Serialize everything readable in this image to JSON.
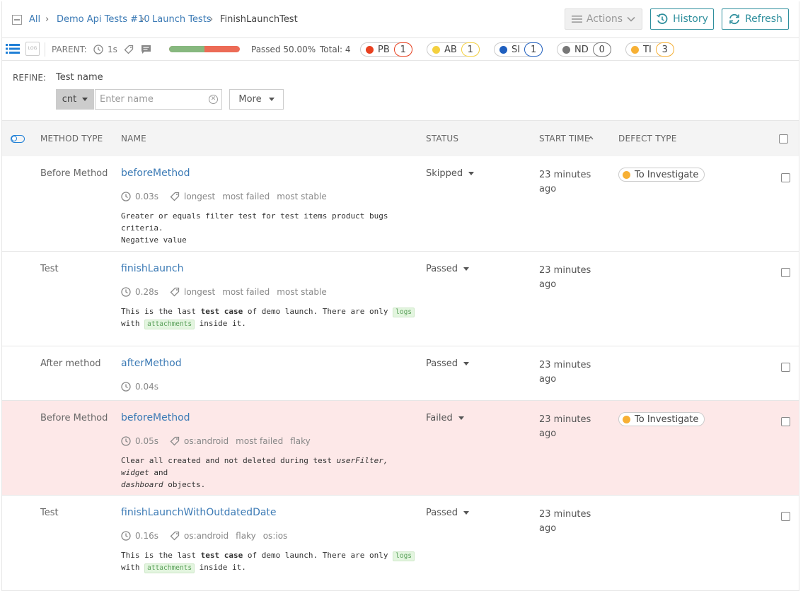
{
  "breadcrumb": {
    "all": "All",
    "launch": "Demo Api Tests #10",
    "suite": "Launch Tests",
    "current": "FinishLaunchTest"
  },
  "toolbar": {
    "actions_label": "Actions",
    "history_label": "History",
    "refresh_label": "Refresh"
  },
  "infobar": {
    "log_label": "LOG",
    "parent_label": "PARENT:",
    "duration": "1s",
    "passed_fraction": 0.5,
    "passed_text": "Passed 50.00%",
    "total_text": "Total: 4",
    "defects": [
      {
        "label": "PB",
        "count": "1",
        "color": "#e8401f"
      },
      {
        "label": "AB",
        "count": "1",
        "color": "#f4d03f"
      },
      {
        "label": "SI",
        "count": "1",
        "color": "#1f5fbf"
      },
      {
        "label": "ND",
        "count": "0",
        "color": "#777777"
      },
      {
        "label": "TI",
        "count": "3",
        "color": "#f7b034"
      }
    ]
  },
  "refine": {
    "label": "REFINE:",
    "field_label": "Test name",
    "condition": "cnt",
    "placeholder": "Enter name",
    "more_label": "More"
  },
  "table": {
    "headers": {
      "method_type": "METHOD TYPE",
      "name": "NAME",
      "status": "STATUS",
      "start_time": "START TIME",
      "defect_type": "DEFECT TYPE"
    },
    "rows": [
      {
        "method_type": "Before Method",
        "name": "beforeMethod",
        "duration": "0.03s",
        "tags": [
          "longest",
          "most failed",
          "most stable"
        ],
        "status": "Skipped",
        "time1": "23 minutes",
        "time2": "ago",
        "defect": "To Investigate",
        "desc1": "Greater or equals filter test for test items product bugs criteria.",
        "desc2": "Negative value"
      },
      {
        "method_type": "Test",
        "name": "finishLaunch",
        "duration": "0.28s",
        "tags": [
          "longest",
          "most failed",
          "most stable"
        ],
        "status": "Passed",
        "time1": "23 minutes",
        "time2": "ago",
        "d_a": "This is the last",
        "d_b": "test case",
        "d_c": "of demo launch. There are only",
        "d_code1": "logs",
        "d_with": "with",
        "d_code2": "attachments",
        "d_end": "inside it."
      },
      {
        "method_type": "After method",
        "name": "afterMethod",
        "duration": "0.04s",
        "status": "Passed",
        "time1": "23 minutes",
        "time2": "ago"
      },
      {
        "method_type": "Before Method",
        "name": "beforeMethod",
        "duration": "0.05s",
        "tags": [
          "os:android",
          "most failed",
          "flaky"
        ],
        "status": "Failed",
        "time1": "23 minutes",
        "time2": "ago",
        "defect": "To Investigate",
        "d_a": "Clear all created and not deleted during test",
        "d_i1": "userFilter,",
        "d_i2": "widget",
        "d_and": "and",
        "d_i3": "dashboard",
        "d_end": "objects."
      },
      {
        "method_type": "Test",
        "name": "finishLaunchWithOutdatedDate",
        "duration": "0.16s",
        "tags": [
          "os:android",
          "flaky",
          "os:ios"
        ],
        "status": "Passed",
        "time1": "23 minutes",
        "time2": "ago",
        "d_a": "This is the last",
        "d_b": "test case",
        "d_c": "of demo launch. There are only",
        "d_code1": "logs",
        "d_with": "with",
        "d_code2": "attachments",
        "d_end": "inside it."
      }
    ]
  }
}
